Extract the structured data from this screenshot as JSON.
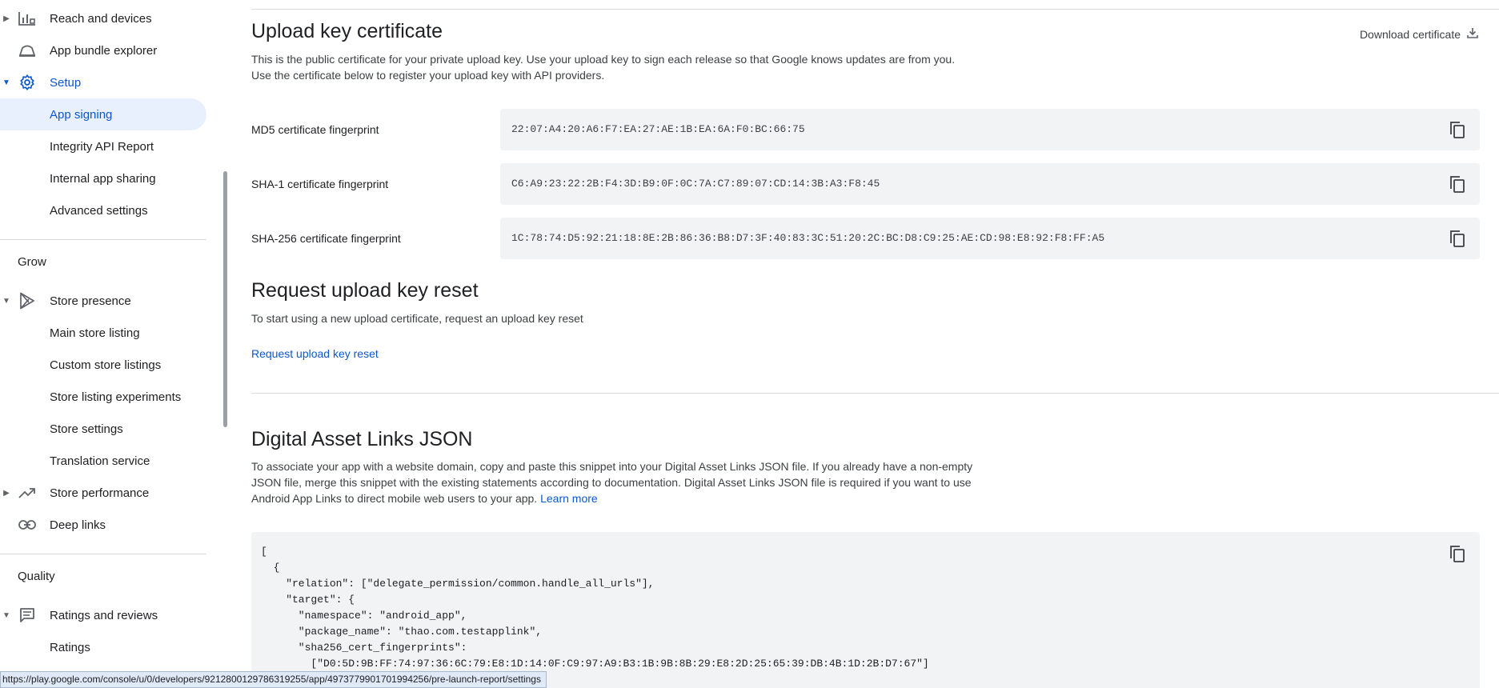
{
  "sidebar": {
    "items": [
      {
        "label": "Reach and devices",
        "icon": "bar-chart-icon"
      },
      {
        "label": "App bundle explorer",
        "icon": "android-bundle-icon"
      },
      {
        "label": "Setup",
        "icon": "gear-icon"
      },
      {
        "label": "App signing"
      },
      {
        "label": "Integrity API Report"
      },
      {
        "label": "Internal app sharing"
      },
      {
        "label": "Advanced settings"
      },
      {
        "label": "Store presence",
        "icon": "play-icon"
      },
      {
        "label": "Main store listing"
      },
      {
        "label": "Custom store listings"
      },
      {
        "label": "Store listing experiments"
      },
      {
        "label": "Store settings"
      },
      {
        "label": "Translation service"
      },
      {
        "label": "Store performance",
        "icon": "trending-up-icon"
      },
      {
        "label": "Deep links",
        "icon": "link-icon"
      },
      {
        "label": "Ratings and reviews",
        "icon": "review-icon"
      },
      {
        "label": "Ratings"
      }
    ],
    "sections": {
      "grow": "Grow",
      "quality": "Quality"
    }
  },
  "upload_cert": {
    "title": "Upload key certificate",
    "description": "This is the public certificate for your private upload key. Use your upload key to sign each release so that Google knows updates are from you. Use the certificate below to register your upload key with API providers.",
    "download_label": "Download certificate",
    "fingerprints": [
      {
        "label": "MD5 certificate fingerprint",
        "value": "22:07:A4:20:A6:F7:EA:27:AE:1B:EA:6A:F0:BC:66:75"
      },
      {
        "label": "SHA-1 certificate fingerprint",
        "value": "C6:A9:23:22:2B:F4:3D:B9:0F:0C:7A:C7:89:07:CD:14:3B:A3:F8:45"
      },
      {
        "label": "SHA-256 certificate fingerprint",
        "value": "1C:78:74:D5:92:21:18:8E:2B:86:36:B8:D7:3F:40:83:3C:51:20:2C:BC:D8:C9:25:AE:CD:98:E8:92:F8:FF:A5"
      }
    ]
  },
  "reset": {
    "title": "Request upload key reset",
    "description": "To start using a new upload certificate, request an upload key reset",
    "link": "Request upload key reset"
  },
  "asset_links": {
    "title": "Digital Asset Links JSON",
    "description": "To associate your app with a website domain, copy and paste this snippet into your Digital Asset Links JSON file. If you already have a non-empty JSON file, merge this snippet with the existing statements according to documentation. Digital Asset Links JSON file is required if you want to use Android App Links to direct mobile web users to your app.",
    "learn_more": "Learn more",
    "code": "[\n  {\n    \"relation\": [\"delegate_permission/common.handle_all_urls\"],\n    \"target\": {\n      \"namespace\": \"android_app\",\n      \"package_name\": \"thao.com.testapplink\",\n      \"sha256_cert_fingerprints\":\n        [\"D0:5D:9B:FF:74:97:36:6C:79:E8:1D:14:0F:C9:97:A9:B3:1B:9B:8B:29:E8:2D:25:65:39:DB:4B:1D:2B:D7:67\"]"
  },
  "status_bar": {
    "url": "https://play.google.com/console/u/0/developers/9212800129786319255/app/4973779901701994256/pre-launch-report/settings"
  },
  "colors": {
    "accent": "#0b57d0",
    "selected_bg": "#e8f0fe",
    "box_bg": "#f1f3f4"
  }
}
